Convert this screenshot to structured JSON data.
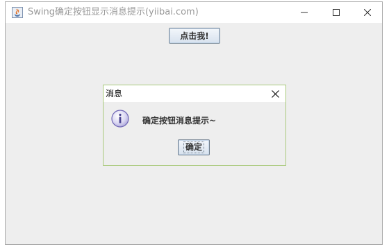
{
  "window": {
    "title": "Swing确定按钮显示消息提示(yiibai.com)",
    "app_icon": "java-icon",
    "controls": [
      "minimize-icon",
      "maximize-icon",
      "close-icon"
    ]
  },
  "main": {
    "button_label": "点击我!"
  },
  "dialog": {
    "title": "消息",
    "icon": "info-icon",
    "message": "确定按钮消息提示~",
    "ok_label": "确定",
    "border_color": "#a8c97a"
  }
}
